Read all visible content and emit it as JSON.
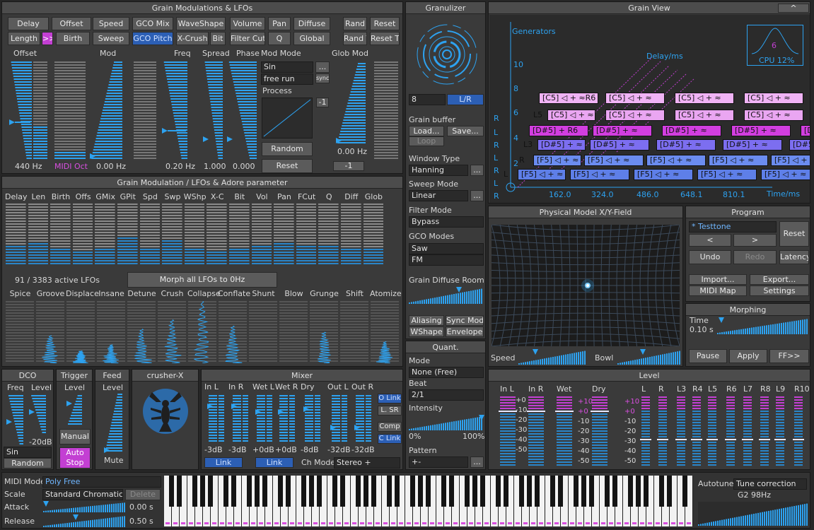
{
  "colors": {
    "accent": "#2da2f0",
    "pink": "#d94fe0",
    "blue_btn": "#2c5fb5"
  },
  "lfo": {
    "title": "Grain Modulations & LFOs",
    "buttons_row1": [
      "Delay",
      "Offset",
      "Speed",
      "GCO Mix",
      "WaveShape",
      "Volume",
      "Pan",
      "Diffuse",
      "Rand",
      "Reset"
    ],
    "buttons_row2": [
      "Length",
      ">>",
      "Birth",
      "Sweep",
      "GCO Pitch",
      "X-Crush",
      "Bit",
      "Filter Cut",
      "Q",
      "Global",
      "Rand T",
      "Reset T"
    ],
    "headers": {
      "offset": "Offset",
      "mod": "Mod",
      "freq": "Freq",
      "spread": "Spread",
      "phase": "Phase",
      "mod_mode": "Mod Mode",
      "glob_mod": "Glob Mod"
    },
    "values": {
      "offset": "440 Hz",
      "mod": "MIDI Oct",
      "mod_hz": "0.00 Hz",
      "freq": "0.20 Hz",
      "spread": "1.000",
      "phase": "0.000",
      "glob": "0.00 Hz",
      "glob_box": "-1"
    },
    "mod_wave": "Sin",
    "mod_run": "free run",
    "sync": "sync",
    "dots": "...",
    "process": "Process",
    "process_val": "-1",
    "random": "Random",
    "reset": "Reset"
  },
  "adore": {
    "title": "Grain Modulation / LFOs & Adore parameter",
    "cols": [
      "Delay",
      "Len",
      "Birth",
      "Offs",
      "GMix",
      "GPit",
      "Spd",
      "Swp",
      "WShp",
      "X-C",
      "Bit",
      "Vol",
      "Pan",
      "FCut",
      "Q",
      "Diff",
      "Glob"
    ],
    "active": "91 / 3383  active LFOs",
    "morph": "Morph all LFOs to 0Hz",
    "effects": [
      "Spice",
      "Groove",
      "Displace",
      "Insane",
      "Detune",
      "Crush",
      "Collapse",
      "Conflate",
      "Shunt",
      "Blow",
      "Grunge",
      "Shift",
      "Atomize"
    ]
  },
  "granulizer": {
    "title": "Granulizer",
    "count": "8",
    "lr": "L/R",
    "grain_buffer": "Grain buffer",
    "load": "Load...",
    "save": "Save...",
    "loop": "Loop",
    "window_type": "Window Type",
    "window_val": "Hanning",
    "dots": "...",
    "sweep_mode": "Sweep Mode",
    "sweep_val": "Linear",
    "filter_mode": "Filter Mode",
    "filter_val": "Bypass",
    "gco_modes": "GCO Modes",
    "gco1": "Saw",
    "gco2": "FM",
    "diffuse_room": "Grain Diffuse Room",
    "aliasing": "Aliasing",
    "sync_mod": "Sync Mod",
    "wshape": "WShape",
    "envelope": "Envelope"
  },
  "quant": {
    "title": "Quant.",
    "mode": "Mode",
    "mode_val": "None (Free)",
    "beat": "Beat",
    "beat_val": "2/1",
    "intensity": "Intensity",
    "p0": "0%",
    "p100": "100%",
    "pattern": "Pattern",
    "pattern_val": "+-",
    "dots": "..."
  },
  "grain_view": {
    "title": "Grain View",
    "caret": "^",
    "generators": "Generators",
    "delay_ms": "Delay/ms",
    "time_ms": "Time/ms",
    "cpu_num": "6",
    "cpu": "CPU 12%",
    "y_ticks": [
      "10",
      "8",
      "6",
      "4",
      "2"
    ],
    "x_ticks": [
      "162.0",
      "324.0",
      "486.0",
      "648.1",
      "810.1"
    ],
    "side": [
      "R",
      "L",
      "R",
      "L",
      "R",
      "L",
      "R",
      "L"
    ],
    "rows": [
      {
        "label": "L",
        "items": [
          "[F5] ◁ + ≈",
          "[F5] ◁ + ≈",
          "[F5] ◁ + ≈",
          "[F5] ◁ + ≈",
          "[F5] ◁ + ≈"
        ],
        "color": "#5e7fe8"
      },
      {
        "label": "R",
        "items": [
          "[F5] ◁ + ≈",
          "[F5] ◁ + ≈",
          "[F5] ◁ + ≈",
          "[F5] ◁ + ≈",
          "[F5] ◁ + ≈"
        ],
        "color": "#6b8cf0"
      },
      {
        "label": "L3",
        "items": [
          "[D#5] + ≈",
          "[D#5] + ≈",
          "[D#5] + ≈",
          "[D#5] + ≈",
          "[D#5] + ≈"
        ],
        "color": "#7c6ef0"
      },
      {
        "label": "",
        "items": [
          "[D#5] + R6",
          "[D#5] + ≈",
          "[D#5] + ≈",
          "[D#5] + ≈",
          "[D#5] + ≈"
        ],
        "color": "#d23ee0"
      },
      {
        "label": "L5",
        "items": [
          "[C5] ◁ + ≈",
          "[C5] ◁ + ≈",
          "[C5] ◁ + ≈",
          "[C5] ◁ + ≈",
          "[C5] ◁ + ≈"
        ],
        "color": "#eaa6f2"
      },
      {
        "label": "",
        "items": [
          "[C5] ◁ + ≈R6",
          "[C5] ◁ + ≈",
          "[C5] ◁ + ≈",
          "[C5] ◁ + ≈",
          "[C5] ◁ + ≈"
        ],
        "color": "#f0b3f5"
      }
    ]
  },
  "xy": {
    "title": "Physical Model X/Y-Field",
    "speed": "Speed",
    "bowl": "Bowl"
  },
  "program": {
    "title": "Program",
    "name": "* Testtone",
    "reset": "Reset",
    "prev": "<",
    "next": ">",
    "undo": "Undo",
    "redo": "Redo",
    "latency": "Latency",
    "import": "Import...",
    "export": "Export...",
    "midimap": "MIDI Map",
    "settings": "Settings"
  },
  "morphing": {
    "title": "Morphing",
    "time": "Time",
    "time_val": "0.10 s",
    "pause": "Pause",
    "apply": "Apply",
    "ff": "FF>>"
  },
  "dco": {
    "title": "DCO",
    "freq": "Freq",
    "level": "Level",
    "level_val": "-20dB",
    "wave": "Sin",
    "random": "Random"
  },
  "trigger": {
    "title": "Trigger",
    "level": "Level",
    "manual": "Manual",
    "auto_stop": "Auto Stop"
  },
  "feed": {
    "title": "Feed",
    "level": "Level",
    "mute": "Mute"
  },
  "crusher": {
    "title": "crusher-X"
  },
  "mixer": {
    "title": "Mixer",
    "cols": [
      "In L",
      "In R",
      "Wet L",
      "Wet R",
      "Dry",
      "Out L",
      "Out R"
    ],
    "vals": [
      "-3dB",
      "-3dB",
      "+0dB",
      "+0dB",
      "-8dB",
      "-32dB",
      "-32dB"
    ],
    "link1": "Link",
    "link2": "Link",
    "chmode": "Ch Mode",
    "chmode_val": "Stereo +",
    "olink": "O Link",
    "lsr": "L. SR",
    "comp": "Comp",
    "clink": "C Link"
  },
  "level": {
    "title": "Level",
    "cols": [
      "In L",
      "In R",
      "Wet",
      "Dry",
      "L",
      "R",
      "L3",
      "R4",
      "L5",
      "R6",
      "L7",
      "R8",
      "L9",
      "R10"
    ],
    "scale": [
      "+0",
      "-10",
      "-20",
      "-30",
      "-40",
      "-50"
    ],
    "scale2": [
      "+10",
      "+0",
      "-10",
      "-20",
      "-30",
      "-40",
      "-50"
    ]
  },
  "midi": {
    "mode": "MIDI Mode",
    "mode_val": "Poly Free",
    "scale": "Scale",
    "scale_val": "Standard Chromatic",
    "delete": "Delete",
    "attack": "Attack",
    "attack_val": "0.00 s",
    "release": "Release",
    "release_val": "0.50 s",
    "autotune": "Autotune",
    "tune_val": "Tune correction",
    "note": "G2 98Hz"
  }
}
